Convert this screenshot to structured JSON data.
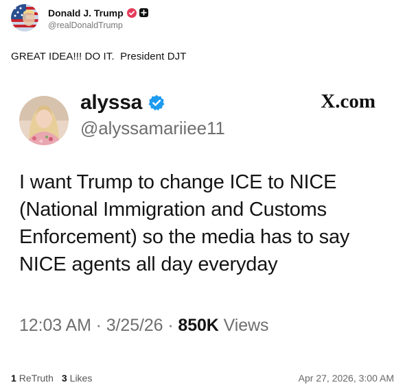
{
  "post": {
    "author": {
      "display_name": "Donald J. Trump",
      "handle": "@realDonaldTrump",
      "avatar_icon": "flag-avatar-icon",
      "verified_icon": "verified-badge-icon",
      "add_icon": "plus-square-icon"
    },
    "text": "GREAT IDEA!!! DO IT.  President DJT"
  },
  "embed": {
    "author": {
      "display_name": "alyssa",
      "handle": "@alyssamariiee11",
      "verified_icon": "verified-badge-icon",
      "avatar_icon": "profile-photo"
    },
    "domain": "X.com",
    "body_lines": [
      "I want Trump to change ICE to NICE",
      "(National Immigration and Customs",
      "Enforcement) so the media has to say",
      "NICE agents all day everyday"
    ],
    "meta": {
      "time": "12:03 AM",
      "separator": " · ",
      "date": "3/25/26",
      "views_count": "850K",
      "views_label": "Views"
    }
  },
  "footer": {
    "retruths_count": "1",
    "retruths_label": "ReTruth",
    "likes_count": "3",
    "likes_label": "Likes",
    "timestamp": "Apr 27, 2026, 3:00 AM"
  },
  "colors": {
    "verified_badge": "#e53b5b",
    "embed_verified": "#1d9bf0",
    "muted_text": "#6f6f6f"
  }
}
